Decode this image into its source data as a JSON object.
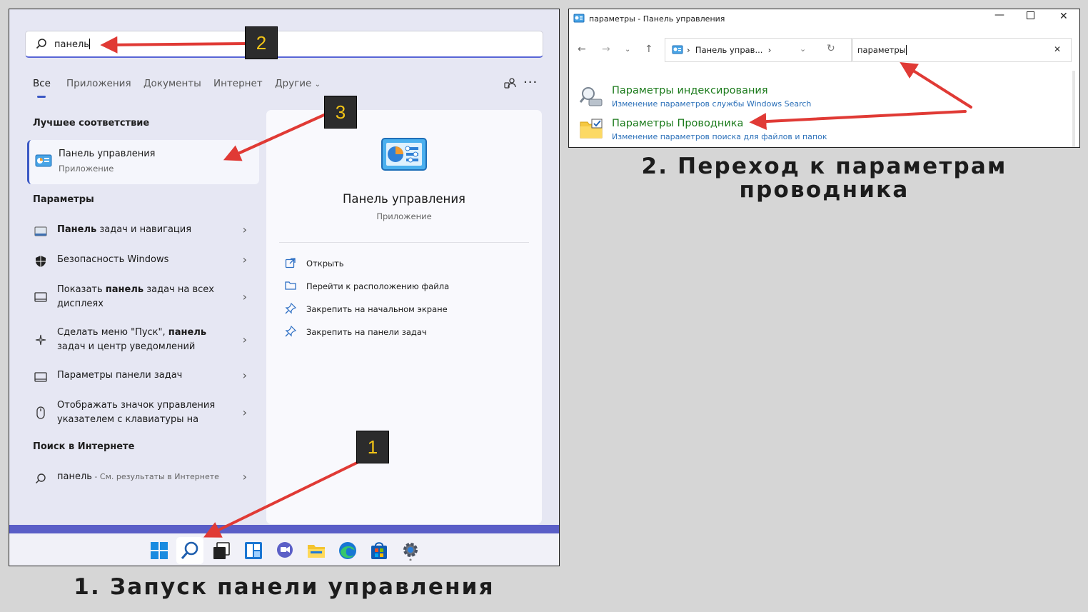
{
  "search_panel": {
    "search_query": "панель",
    "tabs": [
      "Все",
      "Приложения",
      "Документы",
      "Интернет",
      "Другие"
    ],
    "best_match": {
      "heading": "Лучшее соответствие",
      "title": "Панель управления",
      "subtitle": "Приложение"
    },
    "settings": {
      "heading": "Параметры",
      "items": [
        {
          "pre": "",
          "bold": "Панель",
          "post": " задач и навигация",
          "icon": "taskbar-icon"
        },
        {
          "pre": "Безопасность Windows",
          "bold": "",
          "post": "",
          "icon": "shield-icon"
        },
        {
          "pre": "Показать ",
          "bold": "панель",
          "post": " задач на всех дисплеях",
          "icon": "display-icon"
        },
        {
          "pre": "Сделать меню \"Пуск\", ",
          "bold": "панель",
          "post": " задач и центр уведомлений",
          "icon": "sparkle-icon"
        },
        {
          "pre": "Параметры панели задач",
          "bold": "",
          "post": "",
          "icon": "taskbar-icon"
        },
        {
          "pre": "Отображать значок управления указателем с клавиатуры на",
          "bold": "",
          "post": "",
          "icon": "mouse-icon"
        }
      ]
    },
    "web": {
      "heading": "Поиск в Интернете",
      "query": "панель",
      "suffix": " - См. результаты в Интернете"
    },
    "detail": {
      "title": "Панель управления",
      "subtitle": "Приложение",
      "actions": [
        {
          "label": "Открыть",
          "icon": "open-icon"
        },
        {
          "label": "Перейти к расположению файла",
          "icon": "folder-icon"
        },
        {
          "label": "Закрепить на начальном экране",
          "icon": "pin-icon"
        },
        {
          "label": "Закрепить на панели задач",
          "icon": "pin-icon"
        }
      ]
    },
    "taskbar_icons": [
      "windows-start-icon",
      "search-icon",
      "task-view-icon",
      "widgets-icon",
      "chat-icon",
      "file-explorer-icon",
      "edge-icon",
      "store-icon",
      "settings-icon"
    ]
  },
  "control_panel": {
    "window_title": "параметры - Панель управления",
    "address": "Панель управ...",
    "search_value": "параметры",
    "results": [
      {
        "title": "Параметры индексирования",
        "subtitle": "Изменение параметров службы Windows Search",
        "icon": "indexing-icon"
      },
      {
        "title": "Параметры Проводника",
        "subtitle": "Изменение параметров поиска для файлов и папок",
        "icon": "folder-options-icon"
      }
    ]
  },
  "captions": {
    "step1": "1. Запуск панели управления",
    "step2_line1": "2. Переход к параметрам",
    "step2_line2": "проводника"
  },
  "markers": [
    "1",
    "2",
    "3"
  ],
  "colors": {
    "accent": "#3b58c4",
    "taskbar_accent": "#5a5ec7",
    "arrow": "#e03a35",
    "marker_bg": "#2c2c2c",
    "marker_text": "#f2c417",
    "result_link": "#1a7a1a",
    "result_sub": "#2a6fb8"
  }
}
